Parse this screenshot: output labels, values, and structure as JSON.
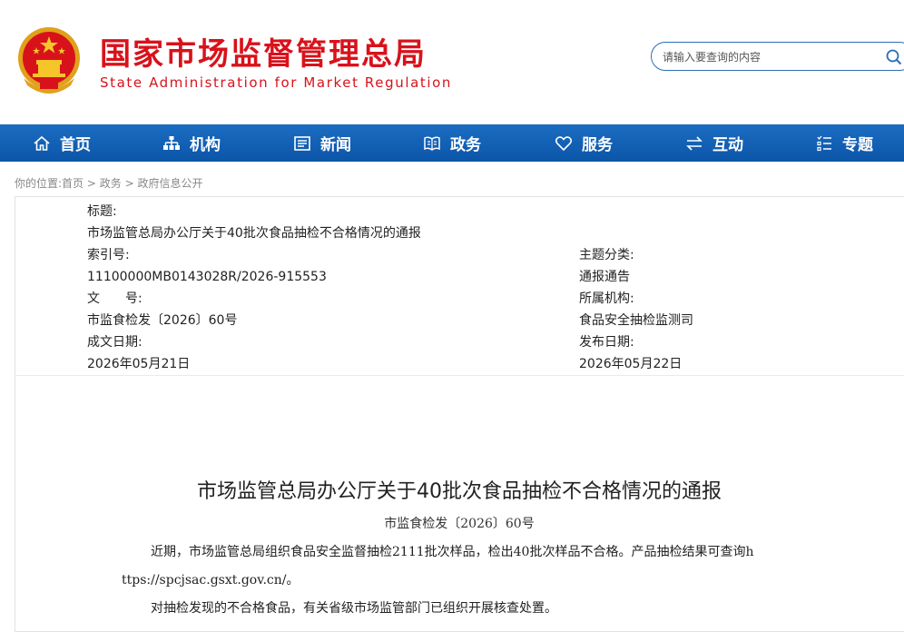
{
  "header": {
    "title": "国家市场监督管理总局",
    "subtitle": "State Administration for Market Regulation",
    "search_placeholder": "请输入要查询的内容"
  },
  "nav": {
    "items": [
      {
        "label": "首页",
        "icon": "home-icon"
      },
      {
        "label": "机构",
        "icon": "org-chart-icon"
      },
      {
        "label": "新闻",
        "icon": "newspaper-icon"
      },
      {
        "label": "政务",
        "icon": "book-icon"
      },
      {
        "label": "服务",
        "icon": "heart-icon"
      },
      {
        "label": "互动",
        "icon": "exchange-arrows-icon"
      },
      {
        "label": "专题",
        "icon": "list-icon"
      }
    ]
  },
  "breadcrumb": {
    "prefix": "你的位置:",
    "items": [
      "首页",
      "政务",
      "政府信息公开"
    ],
    "separator": " > "
  },
  "meta": {
    "title_label": "标题:",
    "title_value": "市场监管总局办公厅关于40批次食品抽检不合格情况的通报",
    "index_label": "索引号:",
    "index_value": "11100000MB0143028R/2026-915553",
    "category_label": "主题分类:",
    "category_value": "通报通告",
    "docno_label": "文　　号:",
    "docno_value": "市监食检发〔2026〕60号",
    "org_label": "所属机构:",
    "org_value": "食品安全抽检监测司",
    "date_written_label": "成文日期:",
    "date_written_value": "2026年05月21日",
    "date_published_label": "发布日期:",
    "date_published_value": "2026年05月22日"
  },
  "document": {
    "title": "市场监管总局办公厅关于40批次食品抽检不合格情况的通报",
    "number": "市监食检发〔2026〕60号",
    "para1_line1": "近期，市场监管总局组织食品安全监督抽检2111批次样品，检出40批次样品不合格。产品抽检结果可查询h",
    "para1_line2": "ttps://spcjsac.gsxt.gov.cn/。",
    "para2": "对抽检发现的不合格食品，有关省级市场监管部门已组织开展核查处置。"
  },
  "colors": {
    "brand_red": "#d8121b",
    "nav_blue": "#0c55a8",
    "search_border": "#2c6eb5"
  }
}
